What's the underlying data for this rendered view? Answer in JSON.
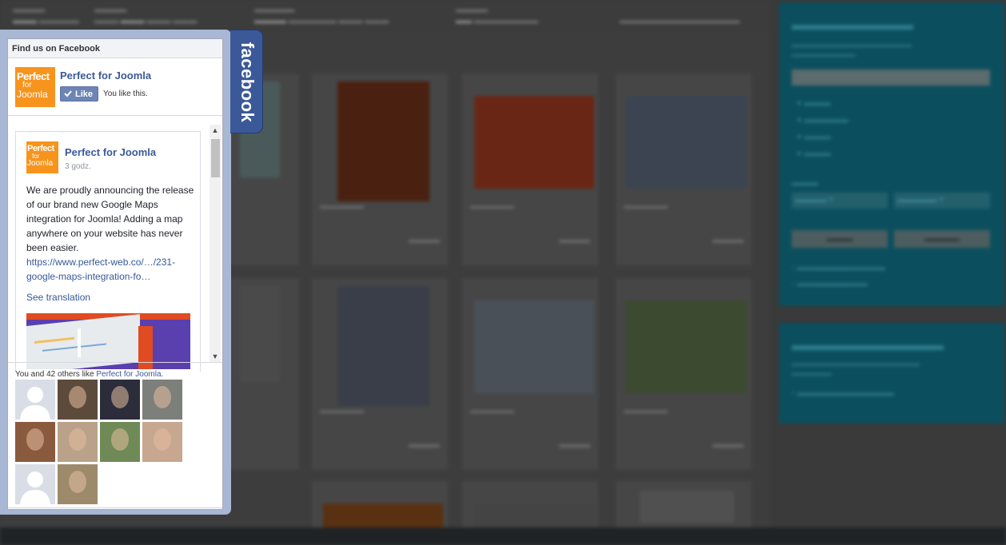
{
  "facebook_widget": {
    "header": "Find us on Facebook",
    "tab_label": "facebook",
    "page": {
      "name": "Perfect for Joomla",
      "logo_lines": [
        "Perfect",
        "for",
        "Joomla"
      ],
      "like_button": "Like",
      "like_status": "You like this."
    },
    "post": {
      "author": "Perfect for Joomla",
      "time": "3 godz.",
      "text": "We are proudly announcing the release of our brand new Google Maps integration for Joomla! Adding a map anywhere on your website has never been easier.",
      "link": "https://www.perfect-web.co/…/231-google-maps-integration-fo…",
      "see_translation": "See translation"
    },
    "fans_text_prefix": "You and 42 others like",
    "fans_text_link": "Perfect for Joomla",
    "fans_text_suffix": ".",
    "fans": [
      {
        "name": "fan-1",
        "color": "#d8dde6"
      },
      {
        "name": "fan-2",
        "color": "#5c4a3b"
      },
      {
        "name": "fan-3",
        "color": "#2c2d3a"
      },
      {
        "name": "fan-4",
        "color": "#7d7f7a"
      },
      {
        "name": "fan-5",
        "color": "#8a5a3f"
      },
      {
        "name": "fan-6",
        "color": "#b9a289"
      },
      {
        "name": "fan-7",
        "color": "#6f8a56"
      },
      {
        "name": "fan-8",
        "color": "#c7a790"
      },
      {
        "name": "fan-9",
        "color": "#d8dde6"
      },
      {
        "name": "fan-10",
        "color": "#9c8a6a"
      }
    ]
  },
  "colors": {
    "facebook_blue": "#3b5998",
    "brand_orange": "#f7941d",
    "panel_frame": "#a7b7d4",
    "sidebar_teal": "#0b4f5e"
  }
}
